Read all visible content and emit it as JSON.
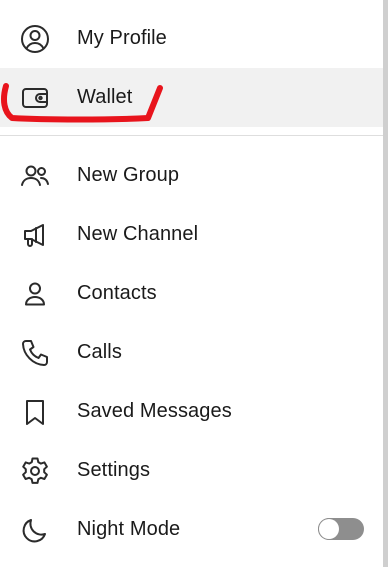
{
  "menu": {
    "items": [
      {
        "label": "My Profile",
        "icon": "user-circle-icon"
      },
      {
        "label": "Wallet",
        "icon": "wallet-icon"
      },
      {
        "label": "New Group",
        "icon": "users-icon"
      },
      {
        "label": "New Channel",
        "icon": "megaphone-icon"
      },
      {
        "label": "Contacts",
        "icon": "user-icon"
      },
      {
        "label": "Calls",
        "icon": "phone-icon"
      },
      {
        "label": "Saved Messages",
        "icon": "bookmark-icon"
      },
      {
        "label": "Settings",
        "icon": "gear-icon"
      },
      {
        "label": "Night Mode",
        "icon": "moon-icon"
      }
    ]
  },
  "night_mode": {
    "enabled": false
  },
  "colors": {
    "hover_bg": "#f1f1f1",
    "annotation": "#e8141c",
    "toggle_off": "#8e8e8e"
  }
}
